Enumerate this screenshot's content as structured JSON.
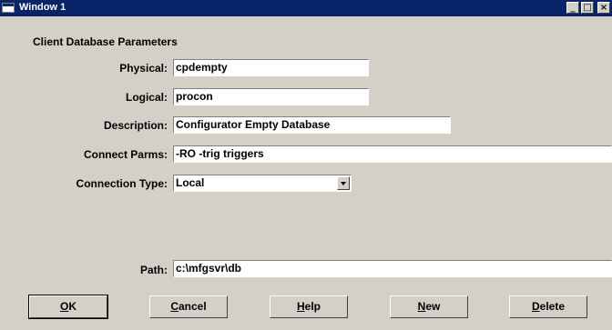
{
  "window": {
    "title": "Window 1",
    "controls": {
      "minimize": "_",
      "maximize": "□",
      "close": "×"
    }
  },
  "section_title": "Client Database Parameters",
  "fields": {
    "physical": {
      "label": "Physical",
      "value": "cpdempty"
    },
    "logical": {
      "label": "Logical",
      "value": "procon"
    },
    "description": {
      "label": "Description",
      "value": "Configurator Empty Database"
    },
    "connect_parms": {
      "label": "Connect Parms",
      "value": "-RO -trig triggers"
    },
    "connection_type": {
      "label": "Connection Type",
      "value": "Local"
    },
    "path": {
      "label": "Path",
      "value": "c:\\mfgsvr\\db"
    }
  },
  "buttons": {
    "ok": {
      "mnemonic": "O",
      "rest": "K"
    },
    "cancel": {
      "mnemonic": "C",
      "rest": "ancel"
    },
    "help": {
      "mnemonic": "H",
      "rest": "elp"
    },
    "new": {
      "mnemonic": "N",
      "rest": "ew"
    },
    "delete": {
      "mnemonic": "D",
      "rest": "elete"
    }
  },
  "colors": {
    "titlebar": "#0a246a",
    "dialog_bg": "#d4d0c8",
    "field_bg": "#ffffff"
  }
}
